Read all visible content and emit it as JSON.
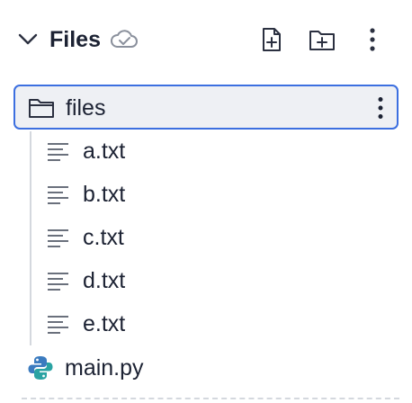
{
  "header": {
    "title": "Files",
    "collapse_icon": "chevron-down-icon",
    "sync_status_icon": "cloud-check-icon",
    "actions": [
      {
        "name": "new-file",
        "icon": "file-plus-icon"
      },
      {
        "name": "new-folder",
        "icon": "folder-plus-icon"
      },
      {
        "name": "more",
        "icon": "more-vertical-icon"
      }
    ]
  },
  "tree": {
    "folder": {
      "label": "files",
      "icon": "folder-icon",
      "selected": true
    },
    "children": [
      {
        "label": "a.txt",
        "icon": "text-file-icon"
      },
      {
        "label": "b.txt",
        "icon": "text-file-icon"
      },
      {
        "label": "c.txt",
        "icon": "text-file-icon"
      },
      {
        "label": "d.txt",
        "icon": "text-file-icon"
      },
      {
        "label": "e.txt",
        "icon": "text-file-icon"
      }
    ],
    "root_files": [
      {
        "label": "main.py",
        "icon": "python-icon"
      }
    ]
  },
  "colors": {
    "accent": "#3c6fe0",
    "selected_bg": "#eef0f4",
    "text": "#1c2233",
    "icon": "#2b3040",
    "python_blue": "#3b7bbf",
    "python_teal": "#2aa3a3"
  }
}
